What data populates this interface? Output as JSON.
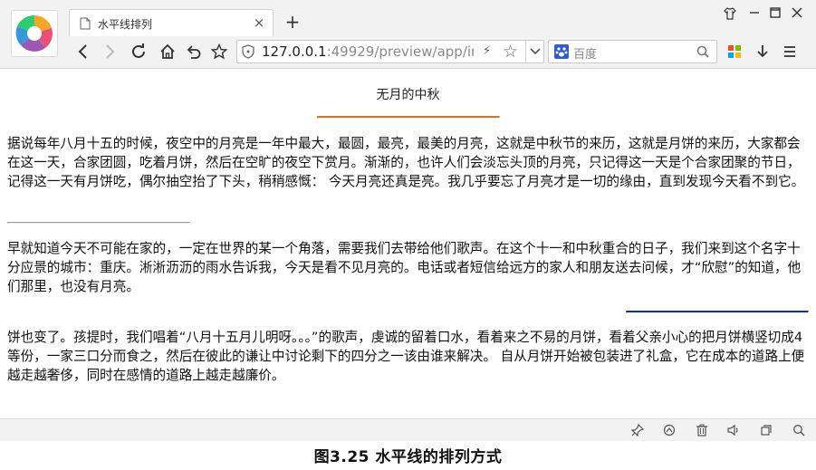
{
  "browser": {
    "tab_title": "水平线排列",
    "tab_close": "×",
    "new_tab": "+",
    "url_host": "127.0.0.1",
    "url_rest": ":49929/preview/app/ir",
    "search_placeholder": "百度",
    "window_controls": {
      "minimize": "−",
      "maximize": "☐",
      "close": "✕"
    }
  },
  "page": {
    "title": "无月的中秋",
    "paragraphs": [
      "据说每年八月十五的时候，夜空中的月亮是一年中最大，最圆，最亮，最美的月亮，这就是中秋节的来历，这就是月饼的来历，大家都会在这一天，合家团圆，吃着月饼，然后在空旷的夜空下赏月。渐渐的，也许人们会淡忘头顶的月亮，只记得这一天是个合家团聚的节日，记得这一天有月饼吃，偶尔抽空抬了下头，稍稍感慨： 今天月亮还真是亮。我几乎要忘了月亮才是一切的缘由，直到发现今天看不到它。",
      "早就知道今天不可能在家的，一定在世界的某一个角落，需要我们去带给他们歌声。在这个十一和中秋重合的日子，我们来到这个名字十分应景的城市：重庆。淅淅沥沥的雨水告诉我，今天是看不见月亮的。电话或者短信给远方的家人和朋友送去问候，才“欣慰”的知道，他们那里，也没有月亮。",
      "饼也变了。孩提时，我们唱着“八月十五月儿明呀。。。”的歌声，虔诚的留着口水，看着来之不易的月饼，看着父亲小心的把月饼横竖切成4等份，一家三口分而食之，然后在彼此的谦让中讨论剩下的四分之一该由谁来解决。 自从月饼开始被包装进了礼盒，它在成本的道路上便越走越奢侈，同时在感情的道路上越走越廉价。"
    ]
  },
  "caption": "图3.25 水平线的排列方式",
  "colors": {
    "hr_top": "#cc7a1e",
    "hr_middle": "#9a9a9a",
    "hr_bottom": "#1c2f9c"
  }
}
